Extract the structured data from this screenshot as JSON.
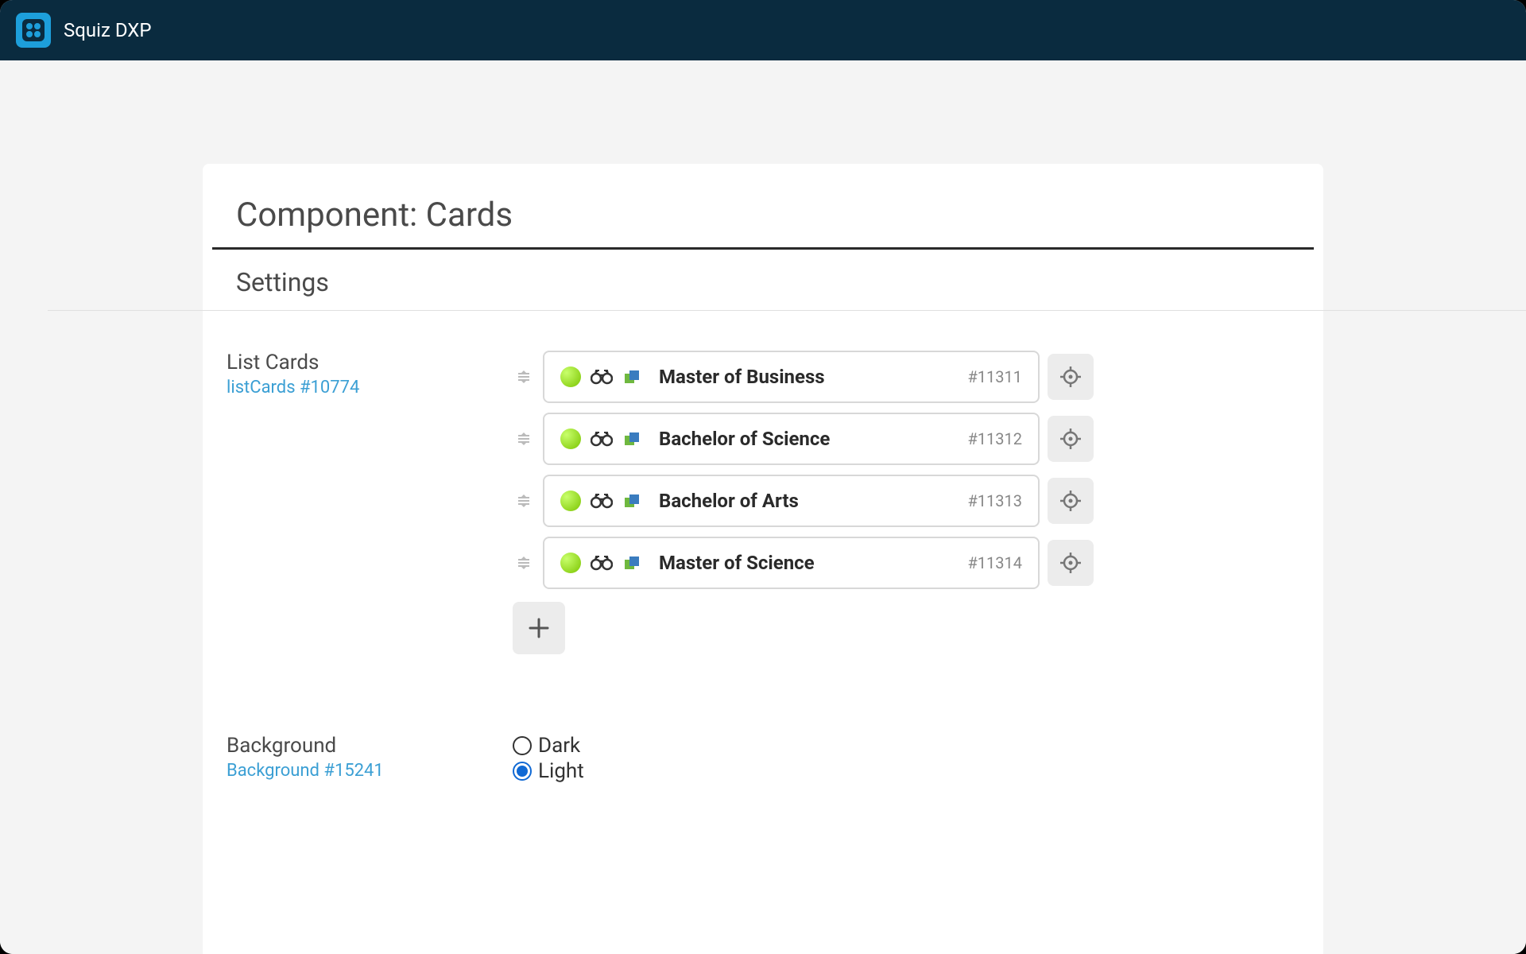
{
  "app": {
    "title": "Squiz DXP"
  },
  "page": {
    "title": "Component: Cards",
    "section": "Settings"
  },
  "listCards": {
    "label": "List Cards",
    "sub": "listCards #10774",
    "items": [
      {
        "name": "Master of Business",
        "id": "#11311"
      },
      {
        "name": "Bachelor of Science",
        "id": "#11312"
      },
      {
        "name": "Bachelor of Arts",
        "id": "#11313"
      },
      {
        "name": "Master of Science",
        "id": "#11314"
      }
    ]
  },
  "background": {
    "label": "Background",
    "sub": "Background #15241",
    "options": [
      {
        "label": "Dark",
        "checked": false
      },
      {
        "label": "Light",
        "checked": true
      }
    ]
  }
}
